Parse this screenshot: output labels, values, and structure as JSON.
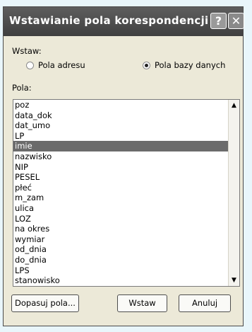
{
  "dialog": {
    "title": "Wstawianie pola korespondencji ...",
    "help_glyph": "?",
    "close_glyph": "✕"
  },
  "insert": {
    "label": "Wstaw:",
    "options": [
      "Pola adresu",
      "Pola bazy danych"
    ],
    "selected": "Pola bazy danych"
  },
  "fields": {
    "label": "Pola:",
    "items": [
      "poz",
      "data_dok",
      "dat_umo",
      "LP",
      "imie",
      "nazwisko",
      "NIP",
      "PESEL",
      "płeć",
      "m_zam",
      "ulica",
      "LOZ",
      "na okres",
      "wymiar",
      "od_dnia",
      "do_dnia",
      "LPS",
      "stanowisko"
    ],
    "selected": "imie"
  },
  "scrollbar": {
    "up_icon": "triangle-up",
    "down_icon": "triangle-down"
  },
  "buttons": {
    "match": "Dopasuj pola...",
    "insert": "Wstaw",
    "cancel": "Anuluj"
  }
}
